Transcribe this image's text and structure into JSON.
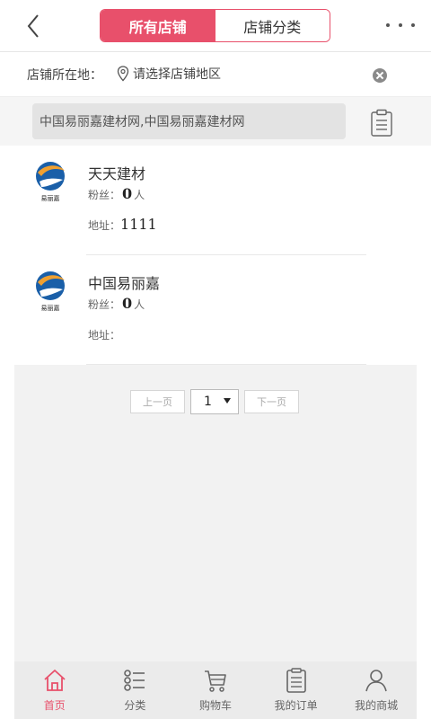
{
  "header": {
    "tabs": [
      {
        "label": "所有店铺",
        "active": true
      },
      {
        "label": "店铺分类",
        "active": false
      }
    ]
  },
  "location": {
    "label": "店铺所在地：",
    "placeholder": "请选择店铺地区"
  },
  "search": {
    "value": "中国易丽嘉建材网,中国易丽嘉建材网"
  },
  "stores": [
    {
      "name": "天天建材",
      "fans_label": "粉丝：",
      "fans_count": "0",
      "fans_unit": "人",
      "address_label": "地址：",
      "address": "1111"
    },
    {
      "name": "中国易丽嘉",
      "fans_label": "粉丝：",
      "fans_count": "0",
      "fans_unit": "人",
      "address_label": "地址：",
      "address": ""
    }
  ],
  "store_logo_text": "易丽嘉",
  "pagination": {
    "prev_label": "上一页",
    "current_page": "1",
    "next_label": "下一页"
  },
  "bottom_nav": [
    {
      "label": "首页",
      "icon": "home-icon",
      "active": true
    },
    {
      "label": "分类",
      "icon": "category-list-icon",
      "active": false
    },
    {
      "label": "购物车",
      "icon": "cart-icon",
      "active": false
    },
    {
      "label": "我的订单",
      "icon": "order-icon",
      "active": false
    },
    {
      "label": "我的商城",
      "icon": "user-icon",
      "active": false
    }
  ],
  "colors": {
    "accent": "#e8506b",
    "logo_blue": "#1a5fa8",
    "logo_orange": "#f0a030"
  }
}
